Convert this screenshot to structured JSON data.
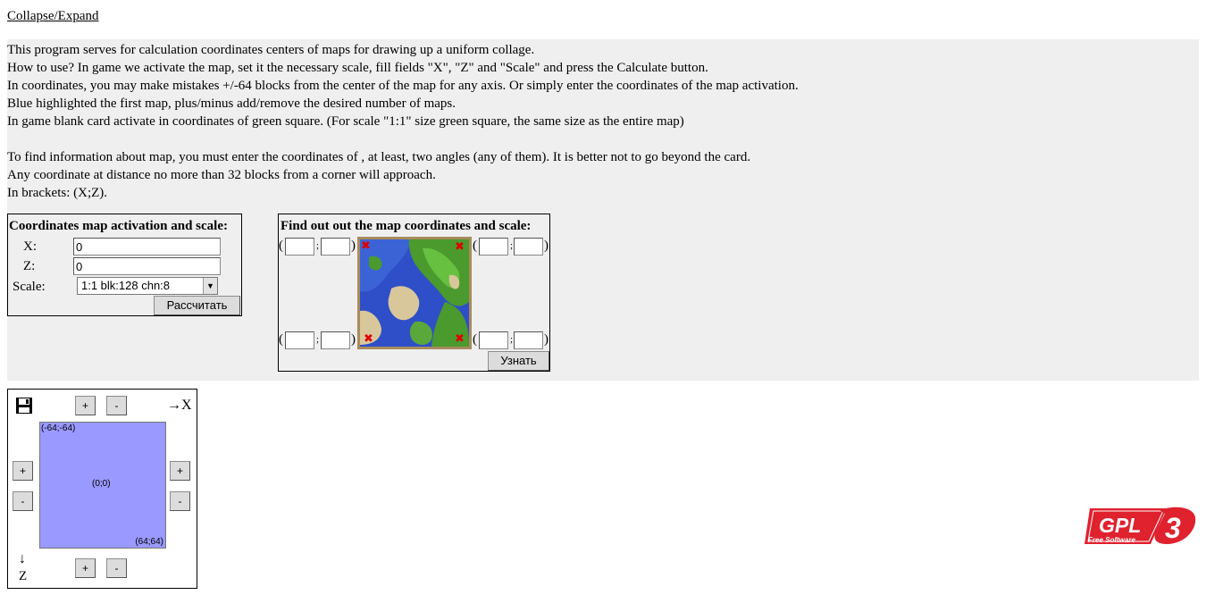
{
  "toggle": {
    "label": "Collapse/Expand"
  },
  "info": {
    "lines": [
      "This program serves for calculation coordinates centers of maps for drawing up a uniform collage.",
      "How to use? In game we activate the map, set it the necessary scale, fill fields \"X\", \"Z\" and \"Scale\" and press the Calculate button.",
      "In coordinates, you may make mistakes +/-64 blocks from the center of the map for any axis. Or simply enter the coordinates of the map activation.",
      "Blue highlighted the first map, plus/minus add/remove the desired number of maps.",
      "In game blank card activate in coordinates of green square. (For scale \"1:1\" size green square, the same size as the entire map)",
      "",
      "To find information about map, you must enter the coordinates of , at least, two angles (any of them). It is better not to go beyond the card.",
      "Any coordinate at distance no more than 32 blocks from a corner will approach.",
      "In brackets: (X;Z)."
    ]
  },
  "activation": {
    "title": "Coordinates map activation and scale:",
    "x_label": "X:",
    "x_value": "0",
    "z_label": "Z:",
    "z_value": "0",
    "scale_label": "Scale:",
    "scale_selected": "1:1 blk:128 chn:8",
    "calc_button": "Рассчитать"
  },
  "finder": {
    "title": "Find out out the map coordinates and scale:",
    "open_paren": "(",
    "close_paren": ")",
    "separator": ";",
    "find_button": "Узнать"
  },
  "collage": {
    "plus": "+",
    "minus": "-",
    "x_axis": "→X",
    "z_arrow": "↓",
    "z_label": "Z",
    "top_left": "(-64;-64)",
    "center": "(0;0)",
    "bottom_right": "(64;64)"
  },
  "logo": {
    "main": "GPL",
    "version": "3",
    "sub": "Free Software"
  },
  "colors": {
    "panel_bg": "#efefef",
    "map_blue": "#9999ff",
    "logo_red": "#e0212e"
  }
}
